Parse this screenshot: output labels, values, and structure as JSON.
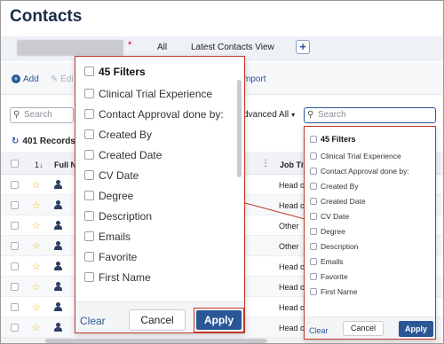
{
  "header": {
    "title": "Contacts"
  },
  "views": {
    "asterisk": "*",
    "tabs": [
      "All",
      "Latest Contacts View"
    ],
    "add_label": "+"
  },
  "toolbar": {
    "add_label": "Add",
    "edit_label": "Edi",
    "import_label": "mport"
  },
  "search": {
    "left_placeholder": "Search",
    "advanced_label": "dvanced All",
    "right_placeholder": "Search"
  },
  "records": {
    "label": "401 Records"
  },
  "grid": {
    "col_num": "1",
    "col_full": "Full N",
    "col_job": "Job Title",
    "rows": [
      {
        "job": "Head o"
      },
      {
        "job": "Head o"
      },
      {
        "job": "Other"
      },
      {
        "job": "Other"
      },
      {
        "job": "Head o"
      },
      {
        "job": "Head o"
      },
      {
        "job": "Head o"
      },
      {
        "job": "Head o"
      }
    ]
  },
  "filter_popup": {
    "header": "45  Filters",
    "items": [
      "Clinical Trial Experience",
      "Contact Approval done by:",
      "Created By",
      "Created Date",
      "CV Date",
      "Degree",
      "Description",
      "Emails",
      "Favorite",
      "First Name"
    ],
    "clear_label": "Clear",
    "cancel_label": "Cancel",
    "apply_label": "Apply"
  },
  "colors": {
    "accent": "#2b5797",
    "highlight": "#c0392b",
    "star": "#f5b400"
  }
}
